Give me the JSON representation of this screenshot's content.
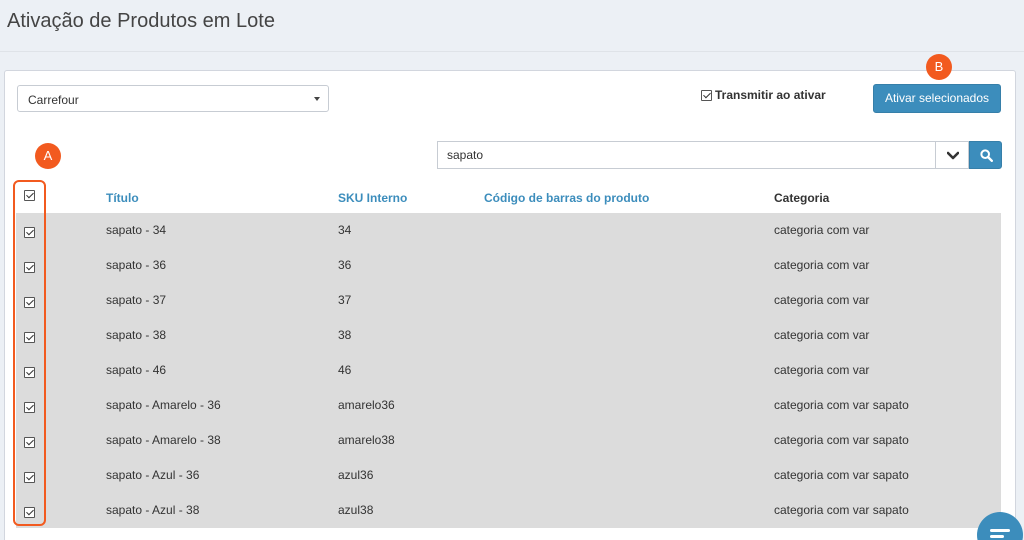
{
  "header": {
    "title": "Ativação de Produtos em Lote"
  },
  "store_select": {
    "value": "Carrefour"
  },
  "transmit": {
    "label": "Transmitir ao ativar",
    "checked": true
  },
  "activate_button": {
    "label": "Ativar selecionados"
  },
  "markers": {
    "a": "A",
    "b": "B"
  },
  "search": {
    "value": "sapato"
  },
  "table": {
    "headers": {
      "title": "Título",
      "sku": "SKU Interno",
      "barcode": "Código de barras do produto",
      "category": "Categoria"
    },
    "rows": [
      {
        "title": "sapato - 34",
        "sku": "34",
        "barcode": "",
        "category": "categoria com var"
      },
      {
        "title": "sapato - 36",
        "sku": "36",
        "barcode": "",
        "category": "categoria com var"
      },
      {
        "title": "sapato - 37",
        "sku": "37",
        "barcode": "",
        "category": "categoria com var"
      },
      {
        "title": "sapato - 38",
        "sku": "38",
        "barcode": "",
        "category": "categoria com var"
      },
      {
        "title": "sapato - 46",
        "sku": "46",
        "barcode": "",
        "category": "categoria com var"
      },
      {
        "title": "sapato - Amarelo - 36",
        "sku": "amarelo36",
        "barcode": "",
        "category": "categoria com var sapato"
      },
      {
        "title": "sapato - Amarelo - 38",
        "sku": "amarelo38",
        "barcode": "",
        "category": "categoria com var sapato"
      },
      {
        "title": "sapato - Azul - 36",
        "sku": "azul36",
        "barcode": "",
        "category": "categoria com var sapato"
      },
      {
        "title": "sapato - Azul - 38",
        "sku": "azul38",
        "barcode": "",
        "category": "categoria com var sapato"
      }
    ]
  },
  "colors": {
    "primary": "#3c8dbc",
    "marker": "#f25a1f",
    "row_bg": "#dcdcdc",
    "page_bg": "#ecf0f5"
  },
  "icons": {
    "dropdown": "chevron-down-icon",
    "search": "search-icon",
    "chat": "chat-icon"
  }
}
